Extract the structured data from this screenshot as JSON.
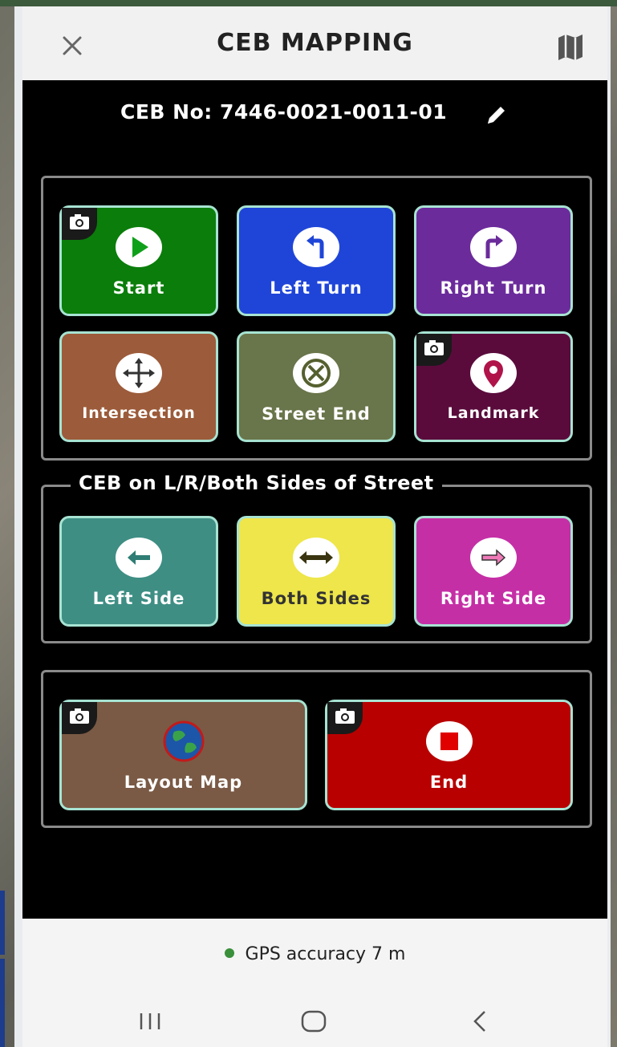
{
  "header": {
    "title": "CEB MAPPING"
  },
  "ceb": {
    "label": "CEB No: 7446-0021-0011-01"
  },
  "group1": {
    "tiles": [
      {
        "label": "Start",
        "icon": "play-icon",
        "color": "#0a7d0a",
        "camera": true
      },
      {
        "label": "Left Turn",
        "icon": "turn-left-icon",
        "color": "#1f45d8",
        "camera": false
      },
      {
        "label": "Right Turn",
        "icon": "turn-right-icon",
        "color": "#6b2b9b",
        "camera": false
      },
      {
        "label": "Intersection",
        "icon": "intersection-icon",
        "color": "#9c5b3a",
        "camera": false
      },
      {
        "label": "Street End",
        "icon": "street-end-icon",
        "color": "#69754a",
        "camera": false
      },
      {
        "label": "Landmark",
        "icon": "location-pin-icon",
        "color": "#5a0b3c",
        "camera": true
      }
    ]
  },
  "group2": {
    "legend": "CEB on L/R/Both Sides of Street",
    "tiles": [
      {
        "label": "Left Side",
        "icon": "arrow-left-icon",
        "color": "#3e8e84"
      },
      {
        "label": "Both Sides",
        "icon": "arrow-both-icon",
        "color": "#eee64a"
      },
      {
        "label": "Right Side",
        "icon": "arrow-right-icon",
        "color": "#c52fa6"
      }
    ]
  },
  "group3": {
    "tiles": [
      {
        "label": "Layout Map",
        "icon": "globe-icon",
        "color": "#7a5a45",
        "camera": true
      },
      {
        "label": "End",
        "icon": "stop-icon",
        "color": "#b80000",
        "camera": true
      }
    ]
  },
  "footer": {
    "gps": "GPS accuracy 7 m"
  }
}
